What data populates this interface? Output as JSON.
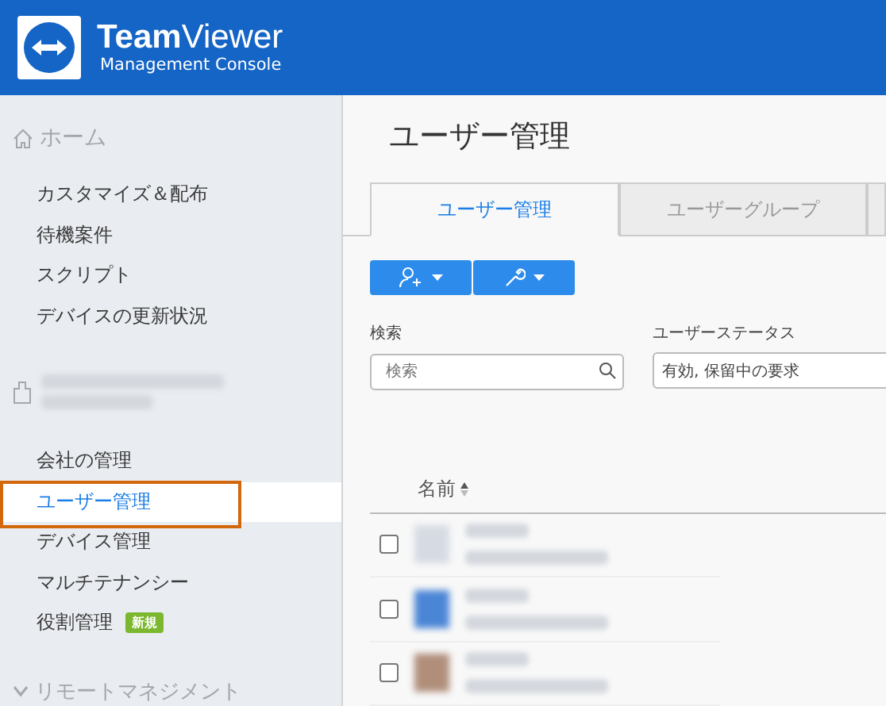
{
  "header": {
    "brand": "**Team**Viewer",
    "subtitle": "Management Console"
  },
  "sidebar": {
    "home": "ホーム",
    "items": [
      {
        "label": "カスタマイズ＆配布",
        "selected": false
      },
      {
        "label": "待機案件",
        "selected": false
      },
      {
        "label": "スクリプト",
        "selected": false
      },
      {
        "label": "デバイスの更新状況",
        "selected": false
      }
    ],
    "company_items": [
      {
        "label": "会社の管理",
        "selected": false
      },
      {
        "label": "ユーザー管理",
        "selected": true
      },
      {
        "label": "デバイス管理",
        "selected": false
      },
      {
        "label": "マルチテナンシー",
        "selected": false
      },
      {
        "label": "役割管理",
        "selected": false,
        "badge": "新規"
      }
    ],
    "section_2": "リモートマネジメント"
  },
  "main": {
    "title": "ユーザー管理",
    "tabs": [
      {
        "label": "ユーザー管理",
        "selected": true
      },
      {
        "label": "ユーザーグループ",
        "selected": false
      }
    ],
    "filters": {
      "search_label": "検索",
      "search": {
        "placeholder": "検索"
      },
      "status_label": "ユーザーステータス",
      "status_value": "有効, 保留中の要求"
    },
    "table": {
      "columns": [
        "名前"
      ],
      "rows": [
        {
          "checked": false,
          "kind": "default"
        },
        {
          "checked": false,
          "kind": "blue"
        },
        {
          "checked": false,
          "kind": "photo"
        }
      ]
    }
  }
}
